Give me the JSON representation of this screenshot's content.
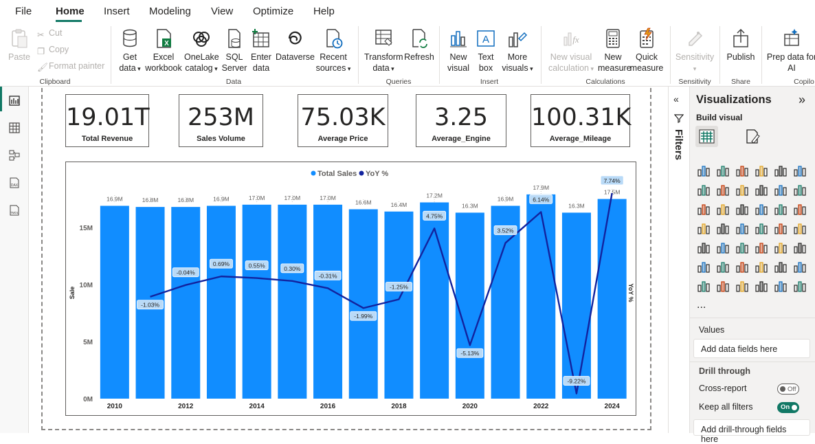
{
  "menu": {
    "items": [
      "File",
      "Home",
      "Insert",
      "Modeling",
      "View",
      "Optimize",
      "Help"
    ],
    "active": "Home"
  },
  "ribbon": {
    "clipboard": {
      "paste": "Paste",
      "cut": "Cut",
      "copy": "Copy",
      "format_painter": "Format painter",
      "group": "Clipboard"
    },
    "data": {
      "get_data": [
        "Get",
        "data"
      ],
      "excel": [
        "Excel",
        "workbook"
      ],
      "onelake": [
        "OneLake",
        "catalog"
      ],
      "sql": [
        "SQL",
        "Server"
      ],
      "enter": [
        "Enter",
        "data"
      ],
      "dataverse": [
        "Dataverse",
        ""
      ],
      "recent": [
        "Recent",
        "sources"
      ],
      "group": "Data"
    },
    "queries": {
      "transform": [
        "Transform",
        "data"
      ],
      "refresh": [
        "Refresh",
        ""
      ],
      "group": "Queries"
    },
    "insert": {
      "new_visual": [
        "New",
        "visual"
      ],
      "text_box": [
        "Text",
        "box"
      ],
      "more_visuals": [
        "More",
        "visuals"
      ],
      "group": "Insert"
    },
    "calculations": {
      "new_visual_calc": [
        "New visual",
        "calculation"
      ],
      "new_measure": [
        "New",
        "measure"
      ],
      "quick_measure": [
        "Quick",
        "measure"
      ],
      "group": "Calculations"
    },
    "sensitivity": {
      "label": [
        "Sensitivity",
        ""
      ],
      "group": "Sensitivity"
    },
    "share": {
      "publish": [
        "Publish",
        ""
      ],
      "group": "Share"
    },
    "copilot": {
      "prep": [
        "Prep data for",
        "AI"
      ],
      "group": "Copilo"
    }
  },
  "cards": [
    {
      "value": "19.01T",
      "label": "Total Revenue"
    },
    {
      "value": "253M",
      "label": "Sales Volume"
    },
    {
      "value": "75.03K",
      "label": "Average Price"
    },
    {
      "value": "3.25",
      "label": "Average_Engine"
    },
    {
      "value": "100.31K",
      "label": "Average_Mileage"
    }
  ],
  "chart_data": {
    "type": "bar",
    "categories": [
      "2010",
      "2011",
      "2012",
      "2013",
      "2014",
      "2015",
      "2016",
      "2017",
      "2018",
      "2019",
      "2020",
      "2021",
      "2022",
      "2023",
      "2024"
    ],
    "x_tick_labels": [
      "2010",
      "",
      "2012",
      "",
      "2014",
      "",
      "2016",
      "",
      "2018",
      "",
      "2020",
      "",
      "2022",
      "",
      "2024"
    ],
    "series": [
      {
        "name": "Total Sales",
        "kind": "bar",
        "color": "#118dff",
        "values": [
          16.9,
          16.8,
          16.8,
          16.9,
          17.0,
          17.0,
          17.0,
          16.6,
          16.4,
          17.2,
          16.3,
          16.9,
          17.9,
          16.3,
          17.5
        ],
        "labels": [
          "16.9M",
          "16.8M",
          "16.8M",
          "16.9M",
          "17.0M",
          "17.0M",
          "17.0M",
          "16.6M",
          "16.4M",
          "17.2M",
          "16.3M",
          "16.9M",
          "17.9M",
          "16.3M",
          "17.5M"
        ]
      },
      {
        "name": "YoY %",
        "kind": "line",
        "color": "#12239e",
        "values": [
          null,
          -1.03,
          -0.04,
          0.69,
          0.55,
          0.3,
          -0.31,
          -1.99,
          -1.25,
          4.75,
          -5.13,
          3.52,
          6.14,
          -9.22,
          7.74
        ],
        "labels": [
          "",
          "-1.03%",
          "-0.04%",
          "0.69%",
          "0.55%",
          "0.30%",
          "-0.31%",
          "-1.99%",
          "-1.25%",
          "4.75%",
          "-5.13%",
          "3.52%",
          "6.14%",
          "-9.22%",
          "7.74%"
        ]
      }
    ],
    "ylabel": "Sale",
    "y2label": "YoY %",
    "y_ticks": [
      "0M",
      "5M",
      "10M",
      "15M"
    ],
    "ylim": [
      0,
      18
    ],
    "y2lim": [
      -10.1,
      10.1
    ],
    "legend": "top-center",
    "grid": false
  },
  "pane": {
    "filters": "Filters",
    "title": "Visualizations",
    "build_visual": "Build visual",
    "more": "...",
    "values": "Values",
    "add_data_fields": "Add data fields here",
    "drill_through": "Drill through",
    "cross_report": "Cross-report",
    "cross_report_state": "Off",
    "keep_all_filters": "Keep all filters",
    "keep_all_filters_state": "On",
    "add_drill_fields": "Add drill-through fields here"
  }
}
